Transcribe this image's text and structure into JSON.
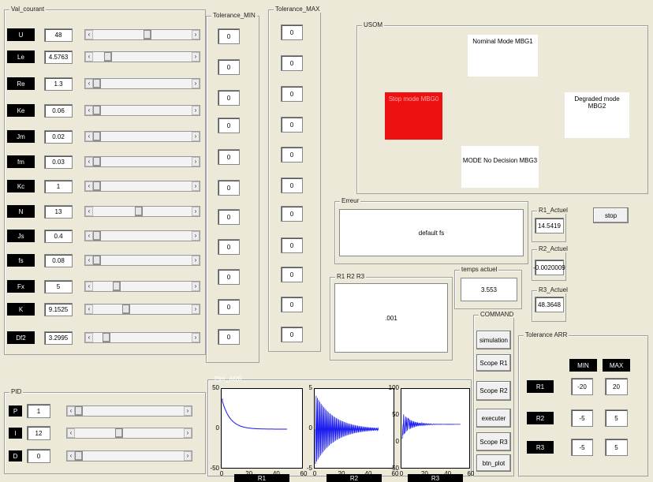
{
  "val_courant": {
    "title": "Val_courant",
    "rows": [
      {
        "label": "U",
        "value": "48",
        "pos": 0.56
      },
      {
        "label": "Le",
        "value": "4.5763",
        "pos": 0.12
      },
      {
        "label": "Re",
        "value": "1.3",
        "pos": 0.0
      },
      {
        "label": "Ke",
        "value": "0.06",
        "pos": 0.0
      },
      {
        "label": "Jm",
        "value": "0.02",
        "pos": 0.0
      },
      {
        "label": "fm",
        "value": "0.03",
        "pos": 0.0
      },
      {
        "label": "Kc",
        "value": "1",
        "pos": 0.0
      },
      {
        "label": "N",
        "value": "13",
        "pos": 0.46
      },
      {
        "label": "Js",
        "value": "0.4",
        "pos": 0.0
      },
      {
        "label": "fs",
        "value": "0.08",
        "pos": 0.0
      },
      {
        "label": "Fx",
        "value": "5",
        "pos": 0.22
      },
      {
        "label": "K",
        "value": "9.1525",
        "pos": 0.32
      },
      {
        "label": "Df2",
        "value": "3.2995",
        "pos": 0.1
      }
    ]
  },
  "tolerance_min": {
    "title": "Tolerance_MIN",
    "values": [
      "0",
      "0",
      "0",
      "0",
      "0",
      "0",
      "0",
      "0",
      "0",
      "0",
      "0",
      "0",
      "0"
    ]
  },
  "tolerance_max": {
    "title": "Tolerance_MAX",
    "values": [
      "0",
      "0",
      "0",
      "0",
      "0",
      "0",
      "0",
      "0",
      "0",
      "0",
      "0",
      "0",
      "0"
    ]
  },
  "usom": {
    "title": "USOM",
    "nominal": "Nominal Mode MBG1",
    "stop": "Stop mode MBG0",
    "degraded": "Degraded mode MBG2",
    "nodecision": "MODE No Decision MBG3",
    "stop_color": "#ee1111"
  },
  "erreur": {
    "title": "Erreur",
    "text": "default fs"
  },
  "r1_actuel": {
    "title": "R1_Actuel",
    "value": "14.5419"
  },
  "r2_actuel": {
    "title": "R2_Actuel",
    "value": "-0.0020009"
  },
  "r3_actuel": {
    "title": "R3_Actuel",
    "value": "48.3648"
  },
  "stop_button": "stop",
  "temps_actuel": {
    "title": "temps actuel",
    "value": "3.553"
  },
  "r1r2r3": {
    "title": "R1 R2 R3",
    "value": ".001"
  },
  "command": {
    "title": "COMMAND",
    "buttons": [
      "simulation",
      "Scope R1",
      "Scope R2",
      "executer",
      "Scope R3",
      "btn_plot"
    ]
  },
  "tolerance_arr": {
    "title": "Tolerance ARR",
    "min_label": "MIN",
    "max_label": "MAX",
    "rows": [
      {
        "label": "R1",
        "min": "-20",
        "max": "20"
      },
      {
        "label": "R2",
        "min": "-5",
        "max": "5"
      },
      {
        "label": "R3",
        "min": "-5",
        "max": "5"
      }
    ]
  },
  "pid": {
    "title": "PID",
    "rows": [
      {
        "label": "P",
        "value": "1",
        "pos": 0.0
      },
      {
        "label": "I",
        "value": "12",
        "pos": 0.4
      },
      {
        "label": "D",
        "value": "0",
        "pos": 0.0
      }
    ]
  },
  "plot_arr": {
    "title": "Plot_ARR",
    "plots": [
      {
        "name": "R1",
        "yticks": [
          "50",
          "0",
          "-50"
        ],
        "xticks": [
          "0",
          "20",
          "40",
          "60"
        ]
      },
      {
        "name": "R2",
        "yticks": [
          "5",
          "0",
          "-5"
        ],
        "xticks": [
          "0",
          "20",
          "40",
          "60"
        ]
      },
      {
        "name": "R3",
        "yticks": [
          "100",
          "50",
          "0",
          "-50"
        ],
        "xticks": [
          "0",
          "20",
          "40",
          "60"
        ]
      }
    ],
    "line_color": "#1a1aee"
  }
}
